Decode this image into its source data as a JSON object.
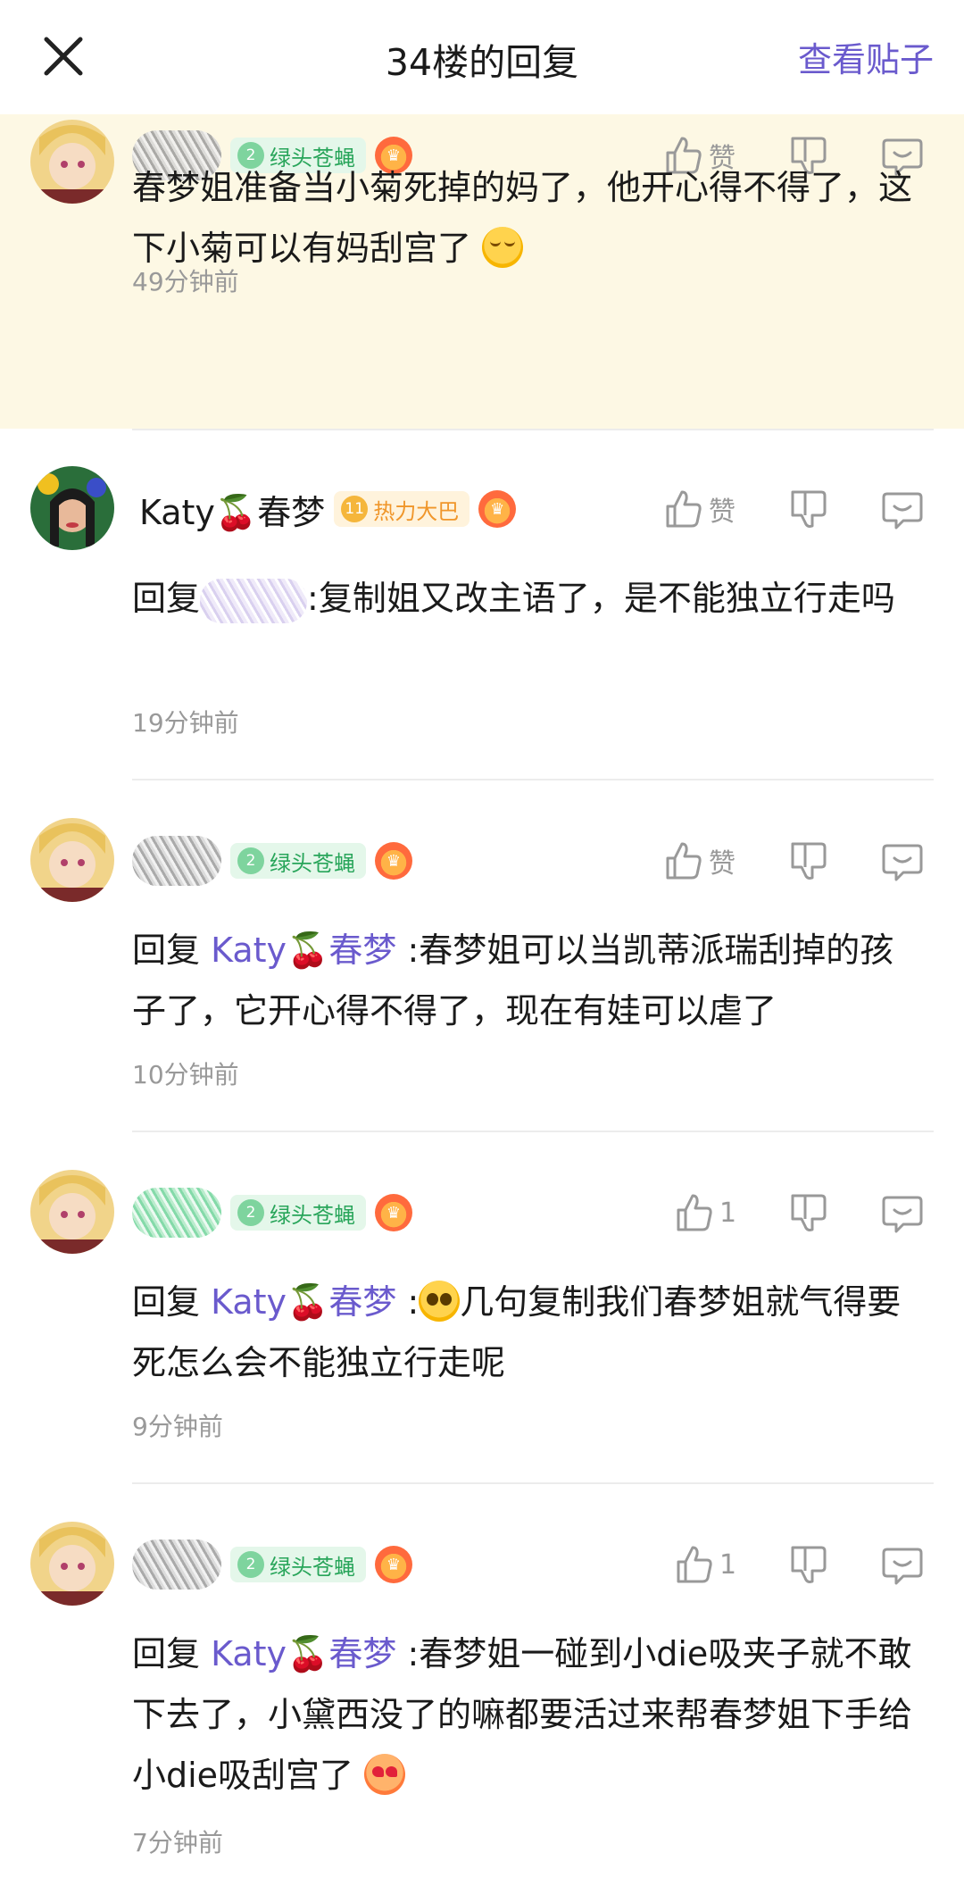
{
  "header": {
    "title": "34楼的回复",
    "view_post": "查看贴子"
  },
  "comments": [
    {
      "user_name": "",
      "badge": {
        "level": "2",
        "label": "绿头苍蝇"
      },
      "text": "春梦姐准备当小菊死掉的妈了，他开心得不得了，这下小菊可以有妈刮宫了",
      "emoji": "hugging-face",
      "time": "49分钟前",
      "like_label": "赞"
    },
    {
      "user_name": "Katy🍒春梦",
      "badge": {
        "level": "11",
        "label": "热力大巴"
      },
      "reply_prefix": "回复",
      "text": ":复制姐又改主语了，是不能独立行走吗",
      "time": "19分钟前",
      "like_label": "赞"
    },
    {
      "user_name": "",
      "badge": {
        "level": "2",
        "label": "绿头苍蝇"
      },
      "reply_prefix": "回复",
      "reply_to": "Katy🍒春梦",
      "text": ":春梦姐可以当凯蒂派瑞刮掉的孩子了，它开心得不得了，现在有娃可以虐了",
      "time": "10分钟前",
      "like_label": "赞"
    },
    {
      "user_name": "",
      "badge": {
        "level": "2",
        "label": "绿头苍蝇"
      },
      "reply_prefix": "回复",
      "reply_to": "Katy🍒春梦",
      "text_before": ":",
      "emoji": "pleading-face",
      "text": "几句复制我们春梦姐就气得要死怎么会不能独立行走呢",
      "time": "9分钟前",
      "like_count": "1"
    },
    {
      "user_name": "",
      "badge": {
        "level": "2",
        "label": "绿头苍蝇"
      },
      "reply_prefix": "回复",
      "reply_to": "Katy🍒春梦",
      "text": ":春梦姐一碰到小die吸夹子就不敢下去了，小黛西没了的嘛都要活过来帮春梦姐下手给小die吸刮宫了",
      "emoji": "heart-eyes-face",
      "time": "7分钟前",
      "like_count": "1"
    }
  ],
  "colors": {
    "accent": "#6a5acd",
    "highlight_bg": "#fdf8e4",
    "muted": "#999999"
  }
}
